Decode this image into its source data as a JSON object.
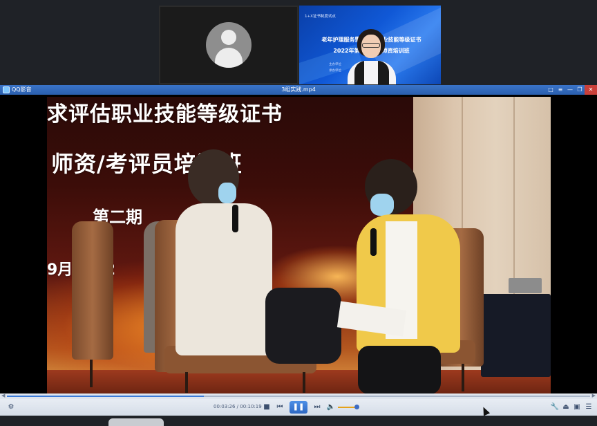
{
  "meeting": {
    "speaker_tile": {
      "tag": "1+X证书制度试点",
      "line1": "老年护理服务需求评估职业技能等级证书",
      "line2": "2022年第一期线上师资培训班",
      "small1": "主办单位",
      "small2": "承办单位"
    }
  },
  "player": {
    "app_name": "QQ影音",
    "file_name": "3组实践.mp4",
    "window_buttons": [
      "□",
      "≡",
      "—",
      "❐",
      "✕"
    ],
    "banner": {
      "line1": "求评估职业技能等级证书",
      "line2": "师资/考评员培训班",
      "line3": "第二期",
      "line4": "9月2日-2"
    },
    "progress_fraction": 0.338,
    "time": "00:03:26 / 00:10:19",
    "volume_fraction": 0.9,
    "colors": {
      "accent": "#2d67c2",
      "titlebar": "#2a5fae",
      "close": "#c9403a"
    }
  }
}
